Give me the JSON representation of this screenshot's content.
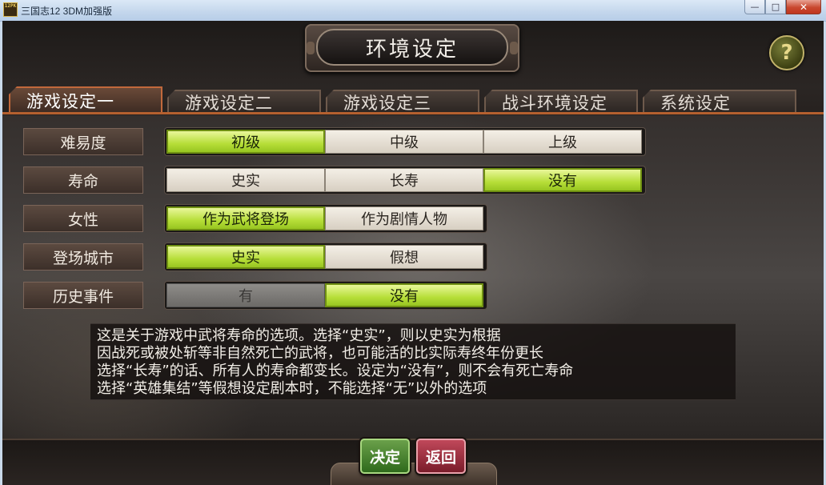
{
  "window": {
    "title": "三国志12 3DM加强版",
    "icon_text": "12PK",
    "controls": [
      "minimize",
      "maximize",
      "close"
    ]
  },
  "header": {
    "title": "环境设定",
    "help_label": "?"
  },
  "tabs": [
    {
      "label": "游戏设定一",
      "active": true
    },
    {
      "label": "游戏设定二",
      "active": false
    },
    {
      "label": "游戏设定三",
      "active": false
    },
    {
      "label": "战斗环境设定",
      "active": false
    },
    {
      "label": "系统设定",
      "active": false
    }
  ],
  "settings": [
    {
      "label": "难易度",
      "options": [
        {
          "label": "初级",
          "state": "selected"
        },
        {
          "label": "中级",
          "state": "normal"
        },
        {
          "label": "上级",
          "state": "normal"
        }
      ]
    },
    {
      "label": "寿命",
      "options": [
        {
          "label": "史实",
          "state": "normal"
        },
        {
          "label": "长寿",
          "state": "normal"
        },
        {
          "label": "没有",
          "state": "selected"
        }
      ]
    },
    {
      "label": "女性",
      "options": [
        {
          "label": "作为武将登场",
          "state": "selected"
        },
        {
          "label": "作为剧情人物",
          "state": "normal"
        }
      ]
    },
    {
      "label": "登场城市",
      "options": [
        {
          "label": "史实",
          "state": "selected"
        },
        {
          "label": "假想",
          "state": "normal"
        }
      ]
    },
    {
      "label": "历史事件",
      "options": [
        {
          "label": "有",
          "state": "disabled"
        },
        {
          "label": "没有",
          "state": "selected"
        }
      ]
    }
  ],
  "description": [
    "这是关于游戏中武将寿命的选项。选择“史实”，则以史实为根据",
    "因战死或被处斩等非自然死亡的武将，也可能活的比实际寿终年份更长",
    "选择“长寿”的话、所有人的寿命都变长。设定为“没有”，则不会有死亡寿命",
    "选择“英雄集结”等假想设定剧本时，不能选择“无”以外的选项"
  ],
  "buttons": {
    "confirm": "决定",
    "back": "返回"
  },
  "colors": {
    "selected": "#b6de38",
    "tab_accent": "#b5602f",
    "confirm": "#2f6a1c",
    "back": "#7a1c2a"
  }
}
